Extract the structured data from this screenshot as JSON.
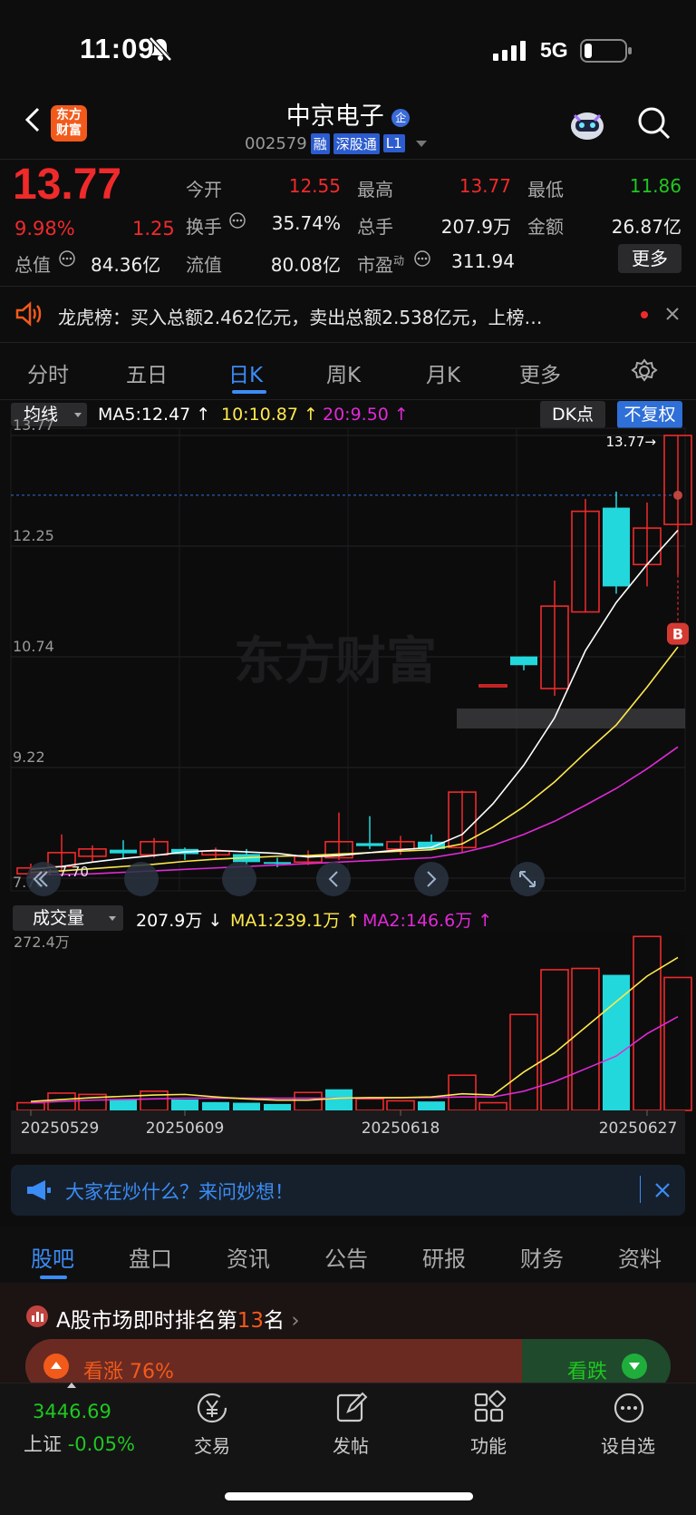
{
  "status_bar": {
    "time": "11:09",
    "network": "5G"
  },
  "header": {
    "logo_line1": "东方",
    "logo_line2": "财富",
    "stock_name": "中京电子",
    "name_badge": "企",
    "code": "002579",
    "tags": [
      "融",
      "深股通",
      "L1"
    ]
  },
  "quote": {
    "price": "13.77",
    "change_pct": "9.98%",
    "change": "1.25",
    "market_cap_label": "总值",
    "market_cap": "84.36亿",
    "float_label": "流值",
    "float_value": "80.08亿",
    "open_label": "今开",
    "open": "12.55",
    "high_label": "最高",
    "high": "13.77",
    "low_label": "最低",
    "low": "11.86",
    "turnover_label": "换手",
    "turnover": "35.74%",
    "volume_label": "总手",
    "volume": "207.9万",
    "amount_label": "金额",
    "amount": "26.87亿",
    "pe_label": "市盈",
    "pe_sup": "动",
    "pe": "311.94",
    "more_button": "更多"
  },
  "notice": {
    "text": "龙虎榜：买入总额2.462亿元，卖出总额2.538亿元，上榜…"
  },
  "chart_tabs": [
    "分时",
    "五日",
    "日K",
    "周K",
    "月K",
    "更多"
  ],
  "active_chart_tab": "日K",
  "indicator": {
    "selector": "均线",
    "ma5": "MA5:12.47",
    "ma10": "10:10.87",
    "ma20": "20:9.50",
    "dk_label": "DK点",
    "adjust_label": "不复权"
  },
  "volume_indicator": {
    "selector": "成交量",
    "vol": "207.9万",
    "ma1": "MA1:239.1万",
    "ma2": "MA2:146.6万",
    "max_label": "272.4万"
  },
  "colors": {
    "up": "#f02a2a",
    "down": "#22d8dc",
    "ma5": "#ffffff",
    "ma10": "#ffe94a",
    "ma20": "#e02ad6",
    "accent": "#2f8af5"
  },
  "chart_data": {
    "type": "candlestick",
    "price_axis_labels": [
      "13.77",
      "12.25",
      "10.74",
      "9.22",
      "7.70"
    ],
    "ylim": [
      7.7,
      13.77
    ],
    "last_price_label": "13.77",
    "low_marker_label": "7.70",
    "buy_marker": "B",
    "dates": [
      "20250529",
      "20250609",
      "20250618",
      "20250627"
    ],
    "candles": [
      {
        "o": 7.76,
        "h": 7.9,
        "l": 7.7,
        "c": 7.84
      },
      {
        "o": 7.86,
        "h": 8.3,
        "l": 7.78,
        "c": 8.05
      },
      {
        "o": 8.0,
        "h": 8.15,
        "l": 7.92,
        "c": 8.1
      },
      {
        "o": 8.09,
        "h": 8.22,
        "l": 7.98,
        "c": 8.04
      },
      {
        "o": 8.02,
        "h": 8.25,
        "l": 7.98,
        "c": 8.2
      },
      {
        "o": 8.1,
        "h": 8.12,
        "l": 7.95,
        "c": 8.03
      },
      {
        "o": 8.02,
        "h": 8.12,
        "l": 7.97,
        "c": 8.07
      },
      {
        "o": 8.03,
        "h": 8.1,
        "l": 7.88,
        "c": 7.92
      },
      {
        "o": 7.92,
        "h": 7.98,
        "l": 7.85,
        "c": 7.9
      },
      {
        "o": 7.92,
        "h": 8.08,
        "l": 7.88,
        "c": 8.0
      },
      {
        "o": 7.98,
        "h": 8.6,
        "l": 7.95,
        "c": 8.2
      },
      {
        "o": 8.18,
        "h": 8.55,
        "l": 8.1,
        "c": 8.14
      },
      {
        "o": 8.1,
        "h": 8.28,
        "l": 8.02,
        "c": 8.2
      },
      {
        "o": 8.2,
        "h": 8.3,
        "l": 8.08,
        "c": 8.1
      },
      {
        "o": 8.12,
        "h": 8.9,
        "l": 8.05,
        "c": 8.88
      },
      {
        "o": 10.35,
        "h": 10.35,
        "l": 10.35,
        "c": 10.35
      },
      {
        "o": 10.74,
        "h": 10.74,
        "l": 10.55,
        "c": 10.62
      },
      {
        "o": 10.3,
        "h": 11.78,
        "l": 10.2,
        "c": 11.43
      },
      {
        "o": 11.35,
        "h": 12.9,
        "l": 11.35,
        "c": 12.73
      },
      {
        "o": 12.78,
        "h": 13.0,
        "l": 11.6,
        "c": 11.7
      },
      {
        "o": 12.0,
        "h": 12.85,
        "l": 11.7,
        "c": 12.5
      },
      {
        "o": 12.55,
        "h": 13.77,
        "l": 11.86,
        "c": 13.77
      }
    ],
    "ma5": [
      7.82,
      7.86,
      7.92,
      7.97,
      8.01,
      8.06,
      8.08,
      8.06,
      8.04,
      7.99,
      8.01,
      8.05,
      8.09,
      8.12,
      8.3,
      8.72,
      9.25,
      9.9,
      10.82,
      11.48,
      12.0,
      12.47
    ],
    "ma10": [
      7.78,
      7.8,
      7.83,
      7.86,
      7.89,
      7.93,
      7.96,
      7.98,
      8.0,
      8.01,
      8.03,
      8.05,
      8.07,
      8.09,
      8.17,
      8.4,
      8.68,
      9.02,
      9.42,
      9.8,
      10.32,
      10.87
    ],
    "ma20": [
      7.74,
      7.75,
      7.76,
      7.78,
      7.8,
      7.82,
      7.84,
      7.86,
      7.88,
      7.9,
      7.92,
      7.94,
      7.96,
      7.98,
      8.05,
      8.15,
      8.3,
      8.48,
      8.7,
      8.93,
      9.2,
      9.5
    ],
    "volume": [
      12,
      27,
      25,
      18,
      30,
      17,
      13,
      12,
      10,
      28,
      33,
      18,
      15,
      14,
      55,
      12,
      150,
      220,
      222,
      212,
      272,
      207.9
    ],
    "volume_down": [
      false,
      false,
      false,
      true,
      false,
      true,
      true,
      true,
      true,
      false,
      true,
      false,
      false,
      true,
      false,
      false,
      false,
      false,
      false,
      true,
      false,
      false
    ],
    "vol_ma1": [
      14,
      17,
      20,
      22,
      24,
      25,
      21,
      18,
      16,
      16,
      19,
      20,
      20,
      21,
      26,
      24,
      60,
      90,
      130,
      170,
      210,
      239.1
    ],
    "vol_ma2": [
      12,
      14,
      16,
      17,
      18,
      19,
      19,
      19,
      19,
      19,
      19,
      19,
      20,
      20,
      21,
      21,
      30,
      45,
      65,
      85,
      120,
      146.6
    ],
    "vol_ylim": [
      0,
      272.4
    ]
  },
  "ask_bar": {
    "text": "大家在炒什么？来问妙想！"
  },
  "bottom_tabs": [
    "股吧",
    "盘口",
    "资讯",
    "公告",
    "研报",
    "财务",
    "资料"
  ],
  "active_bottom_tab": "股吧",
  "ranking": {
    "prefix": "A股市场即时排名第",
    "rank": "13",
    "suffix": "名",
    "bull_label": "看涨 76%",
    "bear_label": "看跌"
  },
  "index": {
    "value": "3446.69",
    "name": "上证",
    "change": "-0.05%"
  },
  "nav": [
    "交易",
    "发帖",
    "功能",
    "设自选"
  ]
}
